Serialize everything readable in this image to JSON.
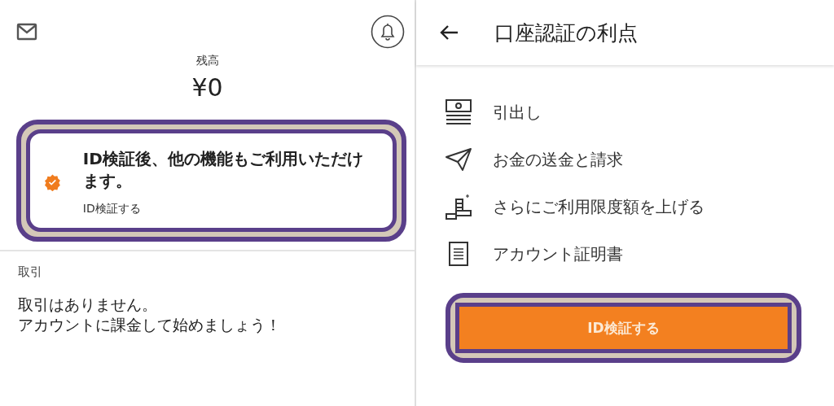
{
  "wallet": {
    "balance_label": "残高",
    "balance": "¥0",
    "verify_card": {
      "message": "ID検証後、他の機能もご利用いただけます。",
      "link": "ID検証する",
      "highlighted": true
    },
    "transactions": {
      "label": "取引",
      "empty_lines": [
        "取引はありません。",
        "アカウントに課金して始めましょう！"
      ]
    }
  },
  "benefits": {
    "title": "口座認証の利点",
    "items": [
      {
        "kind": "cash",
        "label": "引出し"
      },
      {
        "kind": "send",
        "label": "お金の送金と請求"
      },
      {
        "kind": "limit",
        "label": "さらにご利用限度額を上げる"
      },
      {
        "kind": "document",
        "label": "アカウント証明書"
      }
    ],
    "button": {
      "label": "ID検証する",
      "highlighted": true
    }
  }
}
